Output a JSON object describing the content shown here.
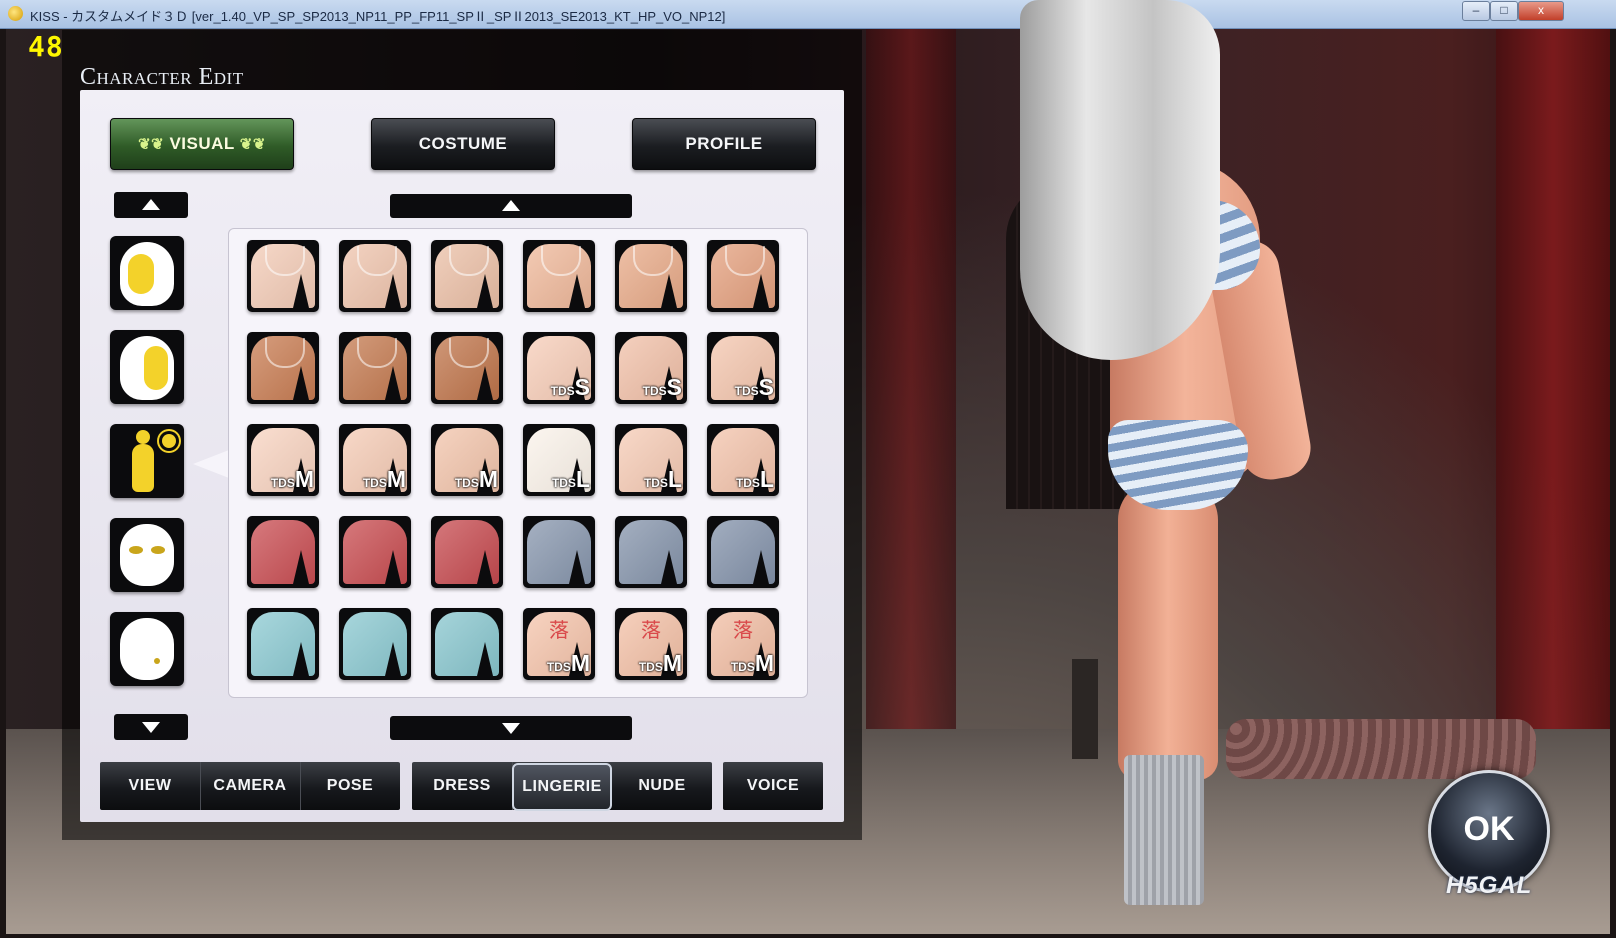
{
  "window": {
    "title": "KISS - カスタムメイド３Ｄ [ver_1.40_VP_SP_SP2013_NP11_PP_FP11_SPⅡ_SPⅡ2013_SE2013_KT_HP_VO_NP12]",
    "minimize_symbol": "–",
    "maximize_symbol": "□",
    "close_symbol": "x"
  },
  "fps_counter": "48",
  "panel": {
    "title": "Character Edit",
    "tabs": [
      {
        "label": "VISUAL",
        "active": true
      },
      {
        "label": "COSTUME",
        "active": false
      },
      {
        "label": "PROFILE",
        "active": false
      }
    ]
  },
  "categories": [
    {
      "icon": "head-front-icon"
    },
    {
      "icon": "head-side-icon"
    },
    {
      "icon": "body-sun-icon"
    },
    {
      "icon": "face-eyes-icon"
    },
    {
      "icon": "face-mole-icon"
    }
  ],
  "swatches": [
    {
      "icon": "skin-tan-light-icon",
      "color": "#f3cbb6",
      "kanji": "",
      "prefix": "",
      "size": ""
    },
    {
      "icon": "skin-tan-light-icon",
      "color": "#efc4ad",
      "kanji": "",
      "prefix": "",
      "size": ""
    },
    {
      "icon": "skin-tan-light-icon",
      "color": "#ebbfa6",
      "kanji": "",
      "prefix": "",
      "size": ""
    },
    {
      "icon": "skin-tan-medium-icon",
      "color": "#efb89a",
      "kanji": "",
      "prefix": "",
      "size": ""
    },
    {
      "icon": "skin-tan-medium-icon",
      "color": "#e8aa88",
      "kanji": "",
      "prefix": "",
      "size": ""
    },
    {
      "icon": "skin-tan-medium-icon",
      "color": "#e4a07e",
      "kanji": "",
      "prefix": "",
      "size": ""
    },
    {
      "icon": "skin-tan-dark-icon",
      "color": "#c87c52",
      "kanji": "",
      "prefix": "",
      "size": ""
    },
    {
      "icon": "skin-tan-dark-icon",
      "color": "#c47a50",
      "kanji": "",
      "prefix": "",
      "size": ""
    },
    {
      "icon": "skin-tan-dark-icon",
      "color": "#bf744a",
      "kanji": "",
      "prefix": "",
      "size": ""
    },
    {
      "icon": "chest-s-icon",
      "color": "#f7cdb8",
      "kanji": "",
      "prefix": "TDS",
      "size": "S"
    },
    {
      "icon": "chest-s-icon",
      "color": "#f1c0a8",
      "kanji": "",
      "prefix": "TDS",
      "size": "S"
    },
    {
      "icon": "chest-s-icon",
      "color": "#f4c6ae",
      "kanji": "",
      "prefix": "TDS",
      "size": "S"
    },
    {
      "icon": "chest-m-icon",
      "color": "#f8d3c0",
      "kanji": "",
      "prefix": "TDS",
      "size": "M"
    },
    {
      "icon": "chest-m-icon",
      "color": "#f5cbb5",
      "kanji": "",
      "prefix": "TDS",
      "size": "M"
    },
    {
      "icon": "chest-m-icon",
      "color": "#f2c4ab",
      "kanji": "",
      "prefix": "TDS",
      "size": "M"
    },
    {
      "icon": "chest-l-icon",
      "color": "#fbf3ea",
      "kanji": "",
      "prefix": "TDS",
      "size": "L"
    },
    {
      "icon": "chest-l-icon",
      "color": "#f6cbb5",
      "kanji": "",
      "prefix": "TDS",
      "size": "L"
    },
    {
      "icon": "chest-l-icon",
      "color": "#f3c3ab",
      "kanji": "",
      "prefix": "TDS",
      "size": "L"
    },
    {
      "icon": "tint-red-icon",
      "color": "#c94d52",
      "kanji": "",
      "prefix": "",
      "size": ""
    },
    {
      "icon": "tint-red-icon",
      "color": "#c84c50",
      "kanji": "",
      "prefix": "",
      "size": ""
    },
    {
      "icon": "tint-red-icon",
      "color": "#c64a4f",
      "kanji": "",
      "prefix": "",
      "size": ""
    },
    {
      "icon": "tint-blue-icon",
      "color": "#8796ad",
      "kanji": "",
      "prefix": "",
      "size": ""
    },
    {
      "icon": "tint-blue-icon",
      "color": "#8594ab",
      "kanji": "",
      "prefix": "",
      "size": ""
    },
    {
      "icon": "tint-blue-icon",
      "color": "#8392aa",
      "kanji": "",
      "prefix": "",
      "size": ""
    },
    {
      "icon": "tint-cyan-icon",
      "color": "#8ccad2",
      "kanji": "",
      "prefix": "",
      "size": ""
    },
    {
      "icon": "tint-cyan-icon",
      "color": "#8ac8d0",
      "kanji": "",
      "prefix": "",
      "size": ""
    },
    {
      "icon": "tint-cyan-icon",
      "color": "#88c6ce",
      "kanji": "",
      "prefix": "",
      "size": ""
    },
    {
      "icon": "graffiti-m-icon",
      "color": "#f5c4ab",
      "kanji": "落",
      "prefix": "TDS",
      "size": "M"
    },
    {
      "icon": "graffiti-m-icon",
      "color": "#f3c0a6",
      "kanji": "落",
      "prefix": "TDS",
      "size": "M"
    },
    {
      "icon": "graffiti-m-icon",
      "color": "#f1bda3",
      "kanji": "落",
      "prefix": "TDS",
      "size": "M"
    }
  ],
  "bottom_bar": {
    "group1": [
      "VIEW",
      "CAMERA",
      "POSE"
    ],
    "group2": [
      "DRESS",
      "LINGERIE",
      "NUDE"
    ],
    "group2_selected": "LINGERIE",
    "group3": [
      "VOICE"
    ]
  },
  "ok_button": "OK",
  "watermark": "H5GAL"
}
